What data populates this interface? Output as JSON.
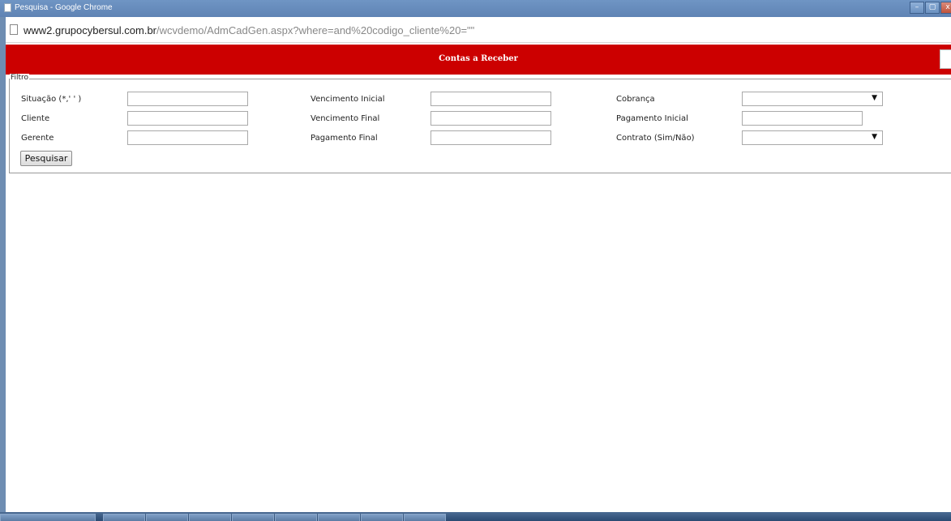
{
  "window": {
    "title": "Pesquisa - Google Chrome"
  },
  "window_controls": {
    "minimize": "–",
    "maximize": "▢",
    "close": "x"
  },
  "address": {
    "host": "www2.grupocybersul.com.br",
    "path": "/wcvdemo/AdmCadGen.aspx?where=and%20codigo_cliente%20=\"\""
  },
  "header": {
    "title": "Contas a Receber"
  },
  "filter": {
    "legend": "Filtro",
    "labels": {
      "situacao": "Situação (*,' ' )",
      "cliente": "Cliente",
      "gerente": "Gerente",
      "vencimento_inicial": "Vencimento Inicial",
      "vencimento_final": "Vencimento Final",
      "pagamento_final": "Pagamento Final",
      "cobranca": "Cobrança",
      "pagamento_inicial": "Pagamento Inicial",
      "contrato": "Contrato (Sim/Não)"
    },
    "values": {
      "situacao": "",
      "cliente": "",
      "gerente": "",
      "vencimento_inicial": "",
      "vencimento_final": "",
      "pagamento_final": "",
      "cobranca": "",
      "pagamento_inicial": "",
      "contrato": ""
    },
    "search_button": "Pesquisar"
  },
  "icons": {
    "dropdown": "▼"
  }
}
